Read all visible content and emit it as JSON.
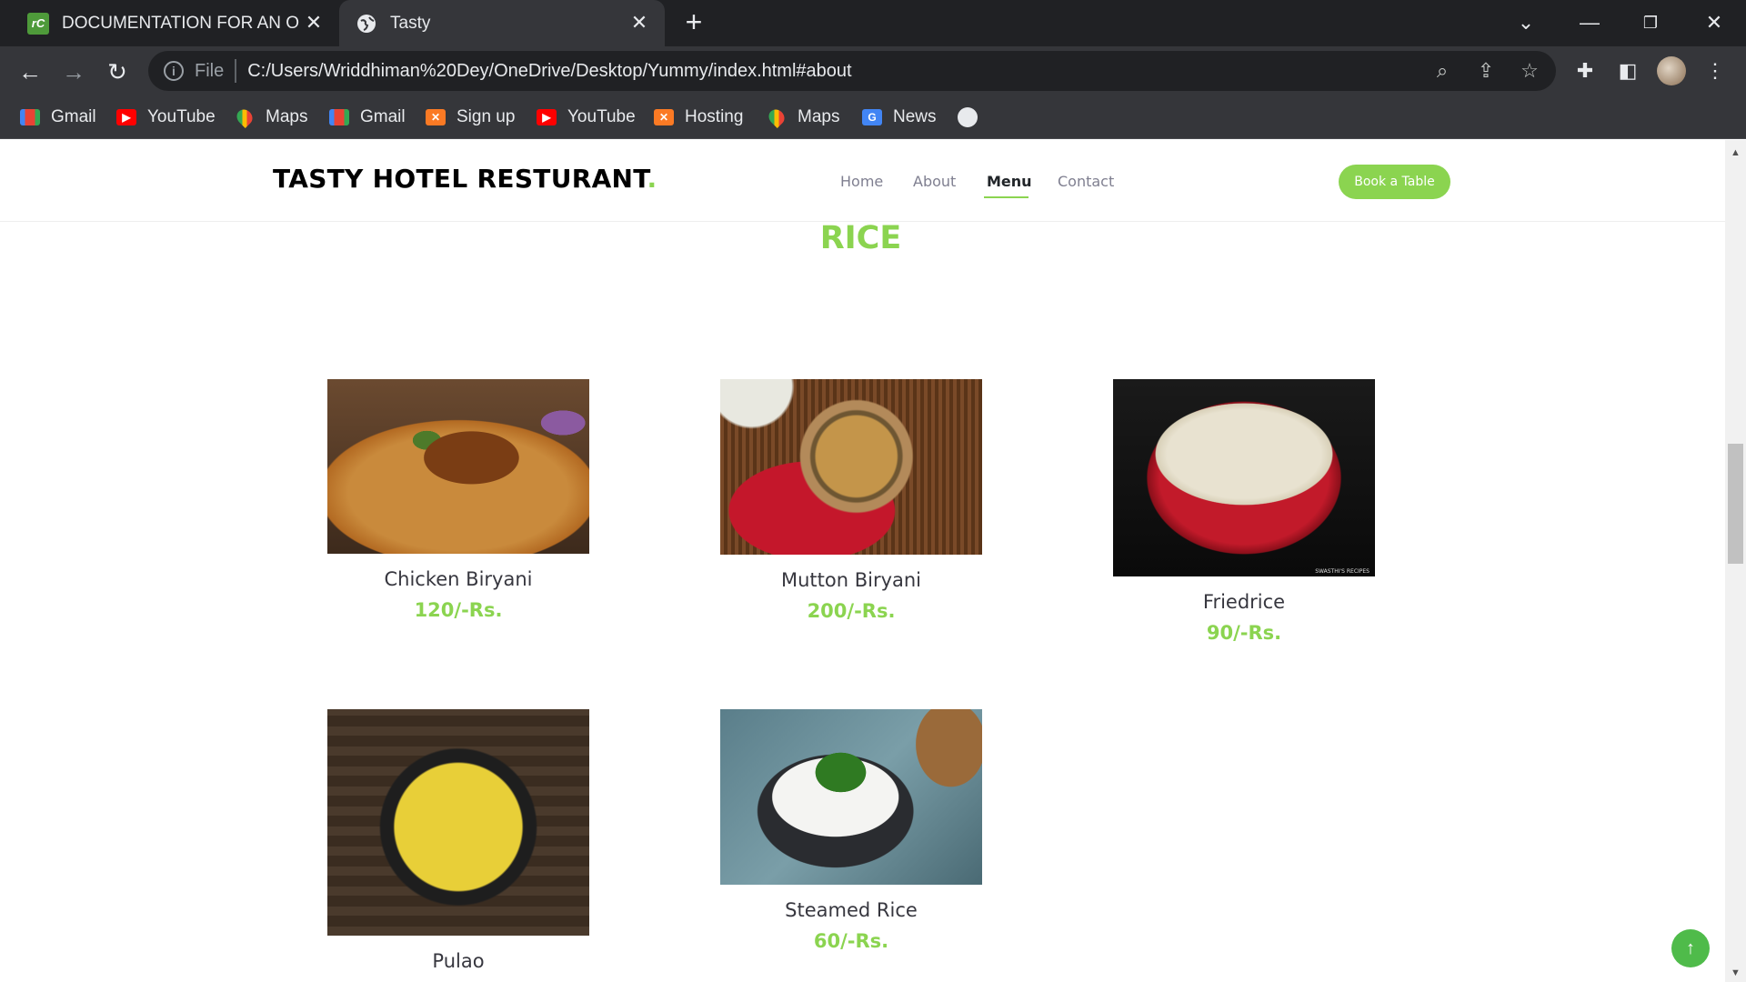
{
  "browser": {
    "tabs": [
      {
        "title": "DOCUMENTATION FOR AN ONLI",
        "favicon": "rc-icon",
        "active": false
      },
      {
        "title": "Tasty",
        "favicon": "globe-icon",
        "active": true
      }
    ],
    "address": {
      "scheme": "File",
      "url": "C:/Users/Wriddhiman%20Dey/OneDrive/Desktop/Yummy/index.html#about"
    },
    "bookmarks": [
      {
        "label": "Gmail",
        "icon": "gmail-icon"
      },
      {
        "label": "YouTube",
        "icon": "youtube-icon"
      },
      {
        "label": "Maps",
        "icon": "maps-icon"
      },
      {
        "label": "Gmail",
        "icon": "gmail-icon"
      },
      {
        "label": "Sign up",
        "icon": "xampp-icon"
      },
      {
        "label": "YouTube",
        "icon": "youtube-icon"
      },
      {
        "label": "Hosting",
        "icon": "xampp-icon"
      },
      {
        "label": "Maps",
        "icon": "maps-icon"
      },
      {
        "label": "News",
        "icon": "news-icon"
      }
    ]
  },
  "site": {
    "logo": "TASTY HOTEL RESTURANT",
    "logo_dot": ".",
    "nav": [
      {
        "label": "Home",
        "active": false
      },
      {
        "label": "About",
        "active": false
      },
      {
        "label": "Menu",
        "active": true
      },
      {
        "label": "Contact",
        "active": false
      }
    ],
    "cta": "Book a Table",
    "accent_color": "#8bd450"
  },
  "section": {
    "title": "RICE",
    "items": [
      {
        "name": "Chicken Biryani",
        "price": "120/-Rs."
      },
      {
        "name": "Mutton Biryani",
        "price": "200/-Rs."
      },
      {
        "name": "Friedrice",
        "price": "90/-Rs.",
        "image_watermark": "SWASTHI'S RECIPES"
      },
      {
        "name": "Pulao",
        "price": ""
      },
      {
        "name": "Steamed Rice",
        "price": "60/-Rs."
      }
    ]
  },
  "scroll_top_icon": "arrow-up-icon"
}
